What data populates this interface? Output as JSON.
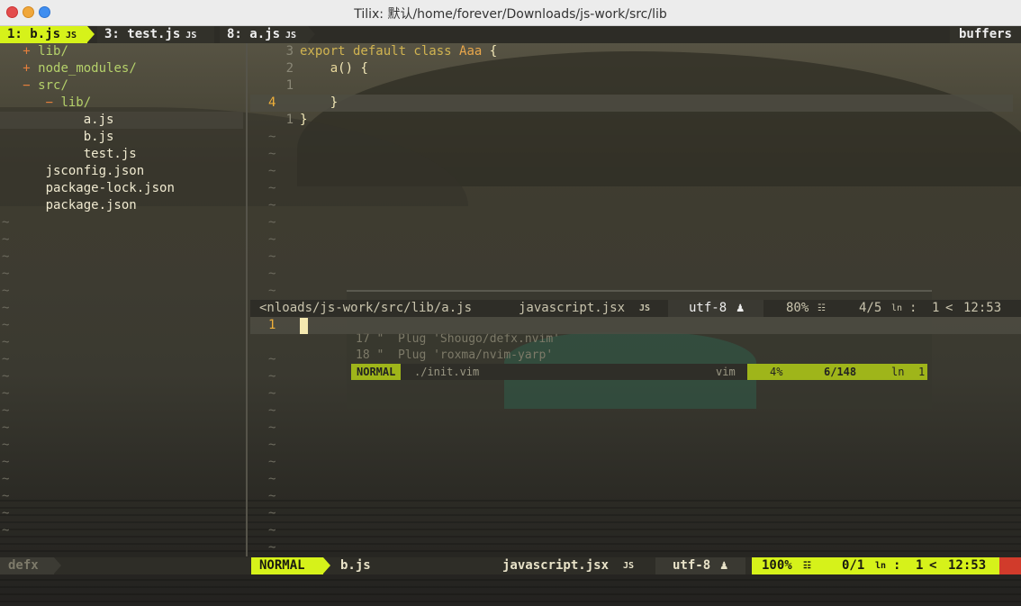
{
  "window": {
    "title": "Tilix: 默认/home/forever/Downloads/js-work/src/lib"
  },
  "tabline": {
    "tabs": [
      {
        "label": "1: b.js",
        "icon": "JS"
      },
      {
        "label": "3: test.js",
        "icon": "JS"
      },
      {
        "label": "8: a.js",
        "icon": "JS"
      }
    ],
    "buffers_label": "buffers"
  },
  "tree": {
    "rows": [
      {
        "mark": "+",
        "name": "lib/"
      },
      {
        "mark": "+",
        "name": "node_modules/"
      },
      {
        "mark": "−",
        "name": "src/"
      },
      {
        "mark": "−",
        "name": "lib/"
      },
      {
        "name": "a.js"
      },
      {
        "name": "b.js"
      },
      {
        "name": "test.js"
      },
      {
        "name": "jsconfig.json"
      },
      {
        "name": "package-lock.json"
      },
      {
        "name": "package.json"
      }
    ],
    "tilde": "~"
  },
  "editor": {
    "lines": [
      {
        "num": "3",
        "kw": "export default class ",
        "cls": "Aaa",
        "rest": " {"
      },
      {
        "num": "2",
        "fn": "    a",
        "rest": "() {"
      },
      {
        "num": "1",
        "rest": ""
      },
      {
        "num": "4",
        "rest": "    }"
      },
      {
        "num": "1",
        "rest": "}"
      }
    ],
    "lower_line": {
      "num": "1"
    }
  },
  "status_top": {
    "path": "<nloads/js-work/src/lib/a.js",
    "filetype": "javascript.jsx",
    "filetype_icon": "JS",
    "encoding": "utf-8",
    "os_icon": "linux-tux-icon",
    "percent": "80%",
    "position": "4/5",
    "ln_label": "ln",
    "col": "1",
    "time": "12:53"
  },
  "status_bottom": {
    "left": "defx",
    "mode": "NORMAL",
    "file": "b.js",
    "filetype": "javascript.jsx",
    "filetype_icon": "JS",
    "encoding": "utf-8",
    "percent": "100%",
    "position": "0/1",
    "ln_label": "ln",
    "col": "1",
    "time": "12:53"
  },
  "ghost": {
    "line1": "17 \"  Plug 'Shougo/defx.nvim'",
    "line2": "18 \"  Plug 'roxma/nvim-yarp'",
    "mode": "NORMAL",
    "file": "./init.vim",
    "ft": "vim",
    "percent": "4%",
    "pos": "6/148",
    "ln": "ln",
    "col": "1"
  },
  "colors": {
    "accent": "#d6f21a",
    "orange": "#e57f3c",
    "red": "#d13b2b"
  }
}
